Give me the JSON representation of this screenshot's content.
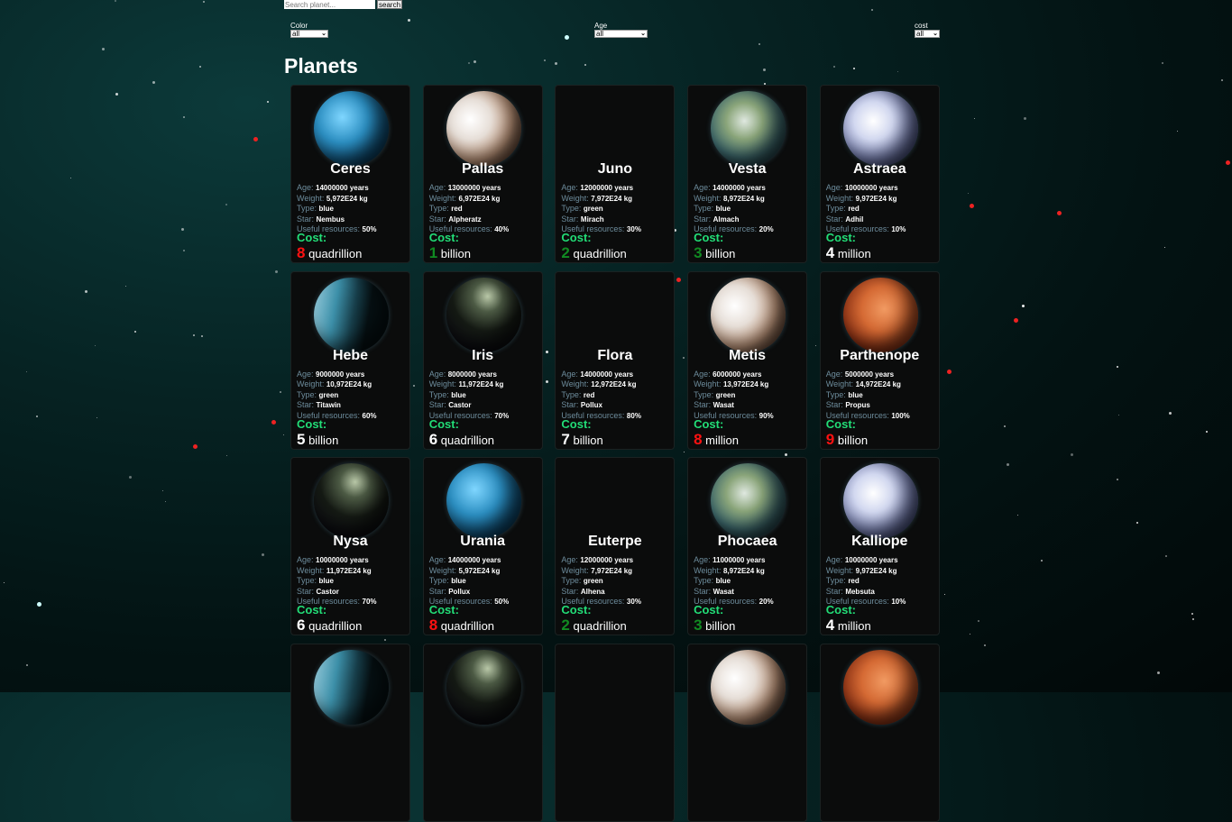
{
  "search": {
    "placeholder": "Search planet...",
    "button_label": "search"
  },
  "filters": [
    {
      "label": "Color",
      "value": "all"
    },
    {
      "label": "Age",
      "value": "all"
    },
    {
      "label": "cost",
      "value": "all"
    }
  ],
  "page_title": "Planets",
  "field_labels": {
    "age": "Age:",
    "weight": "Weight:",
    "type": "Type:",
    "star": "Star:",
    "resources": "Useful resources:",
    "cost": "Cost:"
  },
  "colors": {
    "green": "#22dd77",
    "dark_green": "#118a22",
    "red": "#ff1111",
    "white": "#ffffff"
  },
  "planets": [
    {
      "name": "Ceres",
      "age": "14000000 years",
      "weight": "5,972E24 kg",
      "type": "blue",
      "star": "Nembus",
      "resources": "50%",
      "cost_num": "8",
      "cost_color": "red",
      "cost_unit": "quadrillion",
      "image": "blue-ice"
    },
    {
      "name": "Pallas",
      "age": "13000000 years",
      "weight": "6,972E24 kg",
      "type": "red",
      "star": "Alpheratz",
      "resources": "40%",
      "cost_num": "1",
      "cost_color": "dark_green",
      "cost_unit": "billion",
      "image": "moon-pale"
    },
    {
      "name": "Juno",
      "age": "12000000 years",
      "weight": "7,972E24 kg",
      "type": "green",
      "star": "Mirach",
      "resources": "30%",
      "cost_num": "2",
      "cost_color": "dark_green",
      "cost_unit": "quadrillion",
      "image": ""
    },
    {
      "name": "Vesta",
      "age": "14000000 years",
      "weight": "8,972E24 kg",
      "type": "blue",
      "star": "Almach",
      "resources": "20%",
      "cost_num": "3",
      "cost_color": "dark_green",
      "cost_unit": "billion",
      "image": "earth"
    },
    {
      "name": "Astraea",
      "age": "10000000 years",
      "weight": "9,972E24 kg",
      "type": "red",
      "star": "Adhil",
      "resources": "10%",
      "cost_num": "4",
      "cost_color": "white",
      "cost_unit": "million",
      "image": "cloudy"
    },
    {
      "name": "Hebe",
      "age": "9000000 years",
      "weight": "10,972E24 kg",
      "type": "green",
      "star": "Titawin",
      "resources": "60%",
      "cost_num": "5",
      "cost_color": "white",
      "cost_unit": "billion",
      "image": "half-blue"
    },
    {
      "name": "Iris",
      "age": "8000000 years",
      "weight": "11,972E24 kg",
      "type": "blue",
      "star": "Castor",
      "resources": "70%",
      "cost_num": "6",
      "cost_color": "white",
      "cost_unit": "quadrillion",
      "image": "night"
    },
    {
      "name": "Flora",
      "age": "14000000 years",
      "weight": "12,972E24 kg",
      "type": "red",
      "star": "Pollux",
      "resources": "80%",
      "cost_num": "7",
      "cost_color": "white",
      "cost_unit": "billion",
      "image": ""
    },
    {
      "name": "Metis",
      "age": "6000000 years",
      "weight": "13,972E24 kg",
      "type": "green",
      "star": "Wasat",
      "resources": "90%",
      "cost_num": "8",
      "cost_color": "red",
      "cost_unit": "million",
      "image": "moon-pale"
    },
    {
      "name": "Parthenope",
      "age": "5000000 years",
      "weight": "14,972E24 kg",
      "type": "blue",
      "star": "Propus",
      "resources": "100%",
      "cost_num": "9",
      "cost_color": "red",
      "cost_unit": "billion",
      "image": "mars"
    },
    {
      "name": "Nysa",
      "age": "10000000 years",
      "weight": "11,972E24 kg",
      "type": "blue",
      "star": "Castor",
      "resources": "70%",
      "cost_num": "6",
      "cost_color": "white",
      "cost_unit": "quadrillion",
      "image": "night"
    },
    {
      "name": "Urania",
      "age": "14000000 years",
      "weight": "5,972E24 kg",
      "type": "blue",
      "star": "Pollux",
      "resources": "50%",
      "cost_num": "8",
      "cost_color": "red",
      "cost_unit": "quadrillion",
      "image": "blue-ice"
    },
    {
      "name": "Euterpe",
      "age": "12000000 years",
      "weight": "7,972E24 kg",
      "type": "green",
      "star": "Alhena",
      "resources": "30%",
      "cost_num": "2",
      "cost_color": "dark_green",
      "cost_unit": "quadrillion",
      "image": ""
    },
    {
      "name": "Phocaea",
      "age": "11000000 years",
      "weight": "8,972E24 kg",
      "type": "blue",
      "star": "Wasat",
      "resources": "20%",
      "cost_num": "3",
      "cost_color": "dark_green",
      "cost_unit": "billion",
      "image": "earth"
    },
    {
      "name": "Kalliope",
      "age": "10000000 years",
      "weight": "9,972E24 kg",
      "type": "red",
      "star": "Mebsuta",
      "resources": "10%",
      "cost_num": "4",
      "cost_color": "white",
      "cost_unit": "million",
      "image": "cloudy"
    },
    {
      "image": "half-blue"
    },
    {
      "image": "night"
    },
    {
      "image": ""
    },
    {
      "image": "moon-pale"
    },
    {
      "image": "mars"
    }
  ]
}
